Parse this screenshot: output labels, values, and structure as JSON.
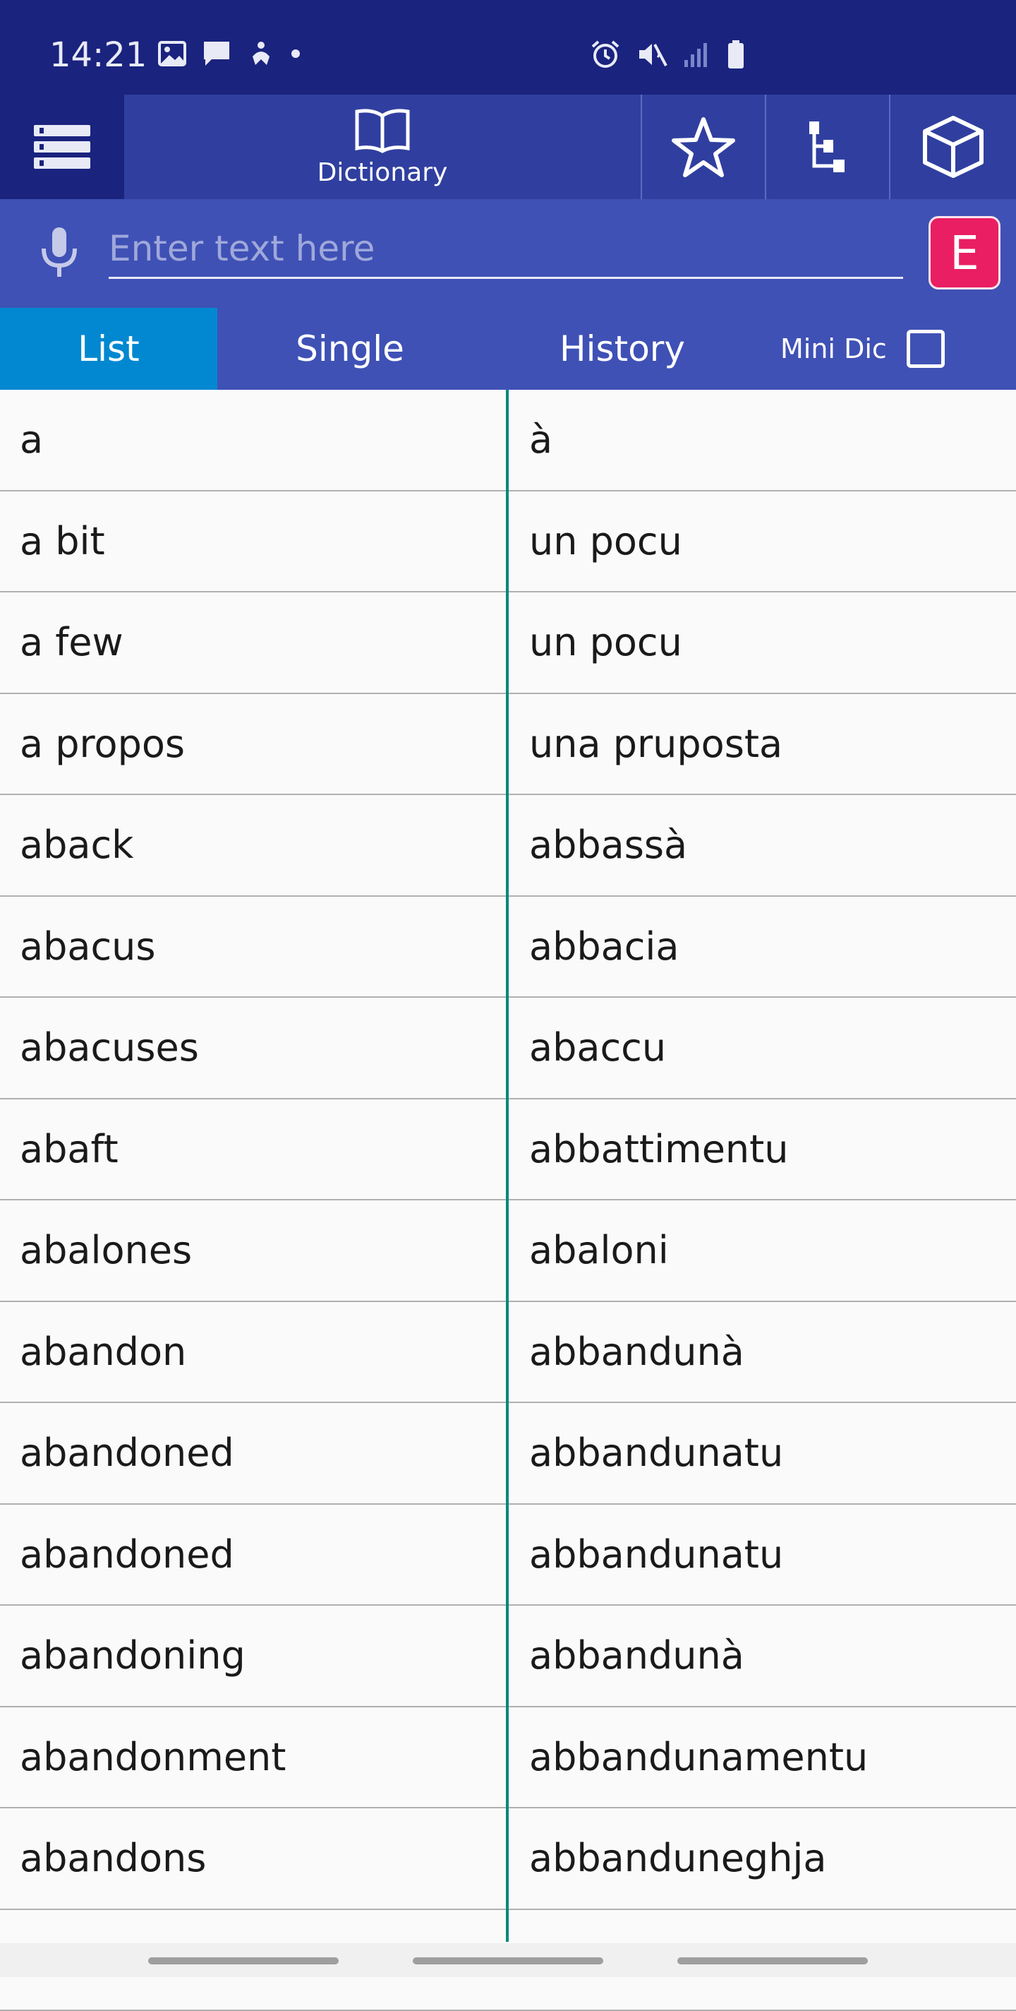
{
  "status_bar": {
    "time": "14:21"
  },
  "app_bar": {
    "dictionary_label": "Dictionary"
  },
  "search": {
    "placeholder": "Enter text here",
    "value": "",
    "language_button": "E"
  },
  "tabs": {
    "list": "List",
    "single": "Single",
    "history": "History",
    "mini_dic": "Mini Dic"
  },
  "entries": [
    {
      "en": "a",
      "co": "à"
    },
    {
      "en": "a bit",
      "co": "un pocu"
    },
    {
      "en": "a few",
      "co": "un pocu"
    },
    {
      "en": "a propos",
      "co": "una pruposta"
    },
    {
      "en": "aback",
      "co": "abbassà"
    },
    {
      "en": "abacus",
      "co": "abbacia"
    },
    {
      "en": "abacuses",
      "co": "abaccu"
    },
    {
      "en": "abaft",
      "co": "abbattimentu"
    },
    {
      "en": "abalones",
      "co": "abaloni"
    },
    {
      "en": "abandon",
      "co": "abbandunà"
    },
    {
      "en": "abandoned",
      "co": "abbandunatu"
    },
    {
      "en": "abandoned",
      "co": "abbandunatu"
    },
    {
      "en": "abandoning",
      "co": "abbandunà"
    },
    {
      "en": "abandonment",
      "co": "abbandunamentu"
    },
    {
      "en": "abandons",
      "co": "abbanduneghja"
    },
    {
      "en": "",
      "co": ""
    }
  ],
  "colors": {
    "primary_dark": "#1a237e",
    "primary": "#3f51b5",
    "tab_active": "#0288d1",
    "accent": "#e91e63",
    "divider": "#00897b"
  }
}
